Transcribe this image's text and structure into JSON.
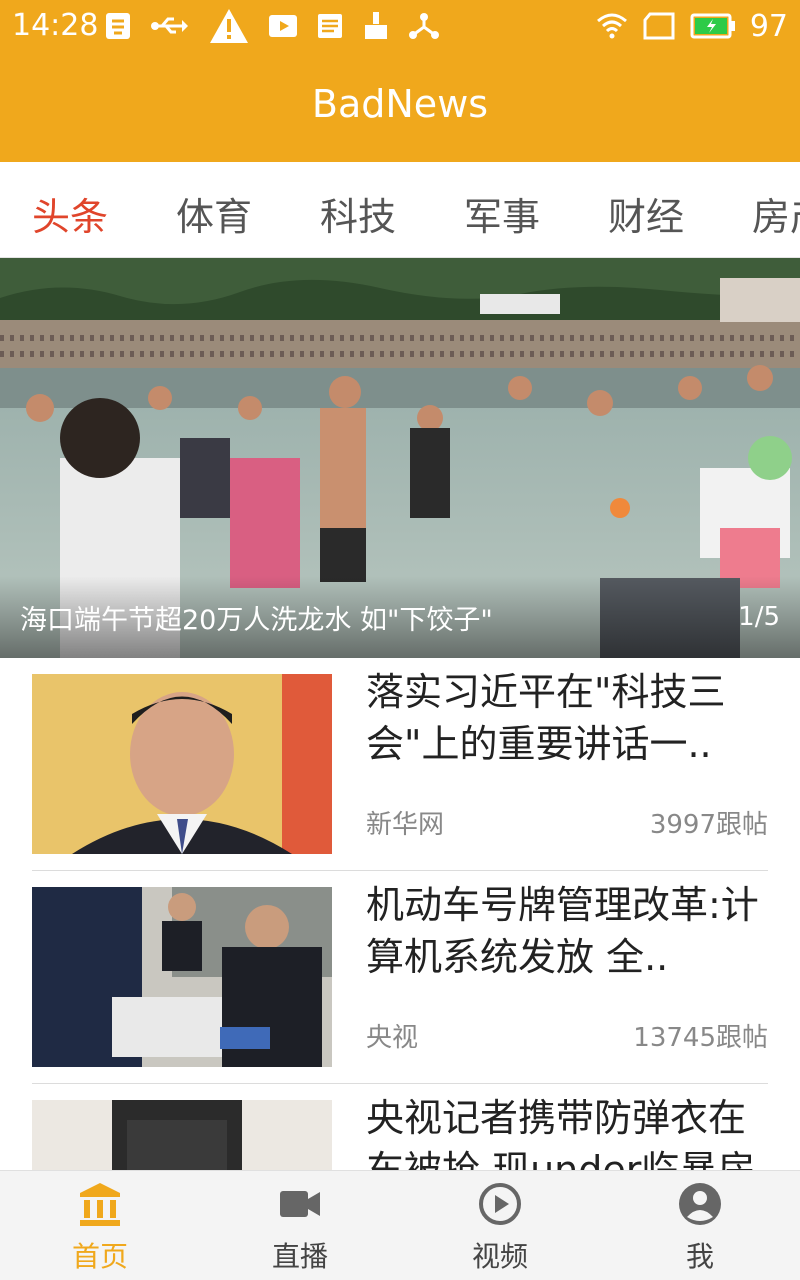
{
  "status_bar": {
    "time": "14:28",
    "battery_level": "97",
    "left_icons": [
      "app-notification-icon",
      "usb-icon",
      "warning-icon",
      "video-icon",
      "document-icon",
      "broom-icon",
      "share-icon"
    ],
    "right_icons": [
      "wifi-icon",
      "sim-icon",
      "battery-charging-icon"
    ]
  },
  "header": {
    "title": "BadNews"
  },
  "tabs": [
    "头条",
    "体育",
    "科技",
    "军事",
    "财经",
    "房产"
  ],
  "active_tab_index": 0,
  "banner": {
    "caption": "海口端午节超20万人洗龙水 如\"下饺子\"",
    "index_text": "1/5"
  },
  "news": [
    {
      "title": "落实习近平在\"科技三会\"上的重要讲话一..",
      "source": "新华网",
      "comments": "3997跟帖"
    },
    {
      "title": "机动车号牌管理改革:计算机系统发放 全..",
      "source": "央视",
      "comments": "13745跟帖"
    },
    {
      "title": "央视记者携带防弹衣在车被抢 现under临暴房",
      "source": "",
      "comments": ""
    }
  ],
  "bottom_nav": [
    {
      "label": "首页",
      "icon": "bank-icon"
    },
    {
      "label": "直播",
      "icon": "video-camera-icon"
    },
    {
      "label": "视频",
      "icon": "play-circle-icon"
    },
    {
      "label": "我",
      "icon": "user-icon"
    }
  ],
  "colors": {
    "accent": "#F0A81C",
    "active_tab": "#E0452B",
    "text": "#222222",
    "meta": "#888888"
  }
}
